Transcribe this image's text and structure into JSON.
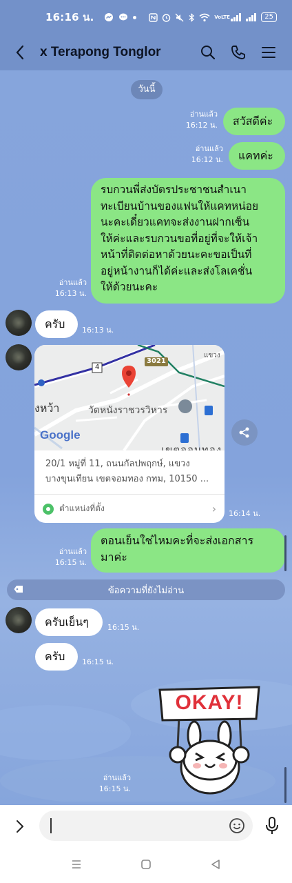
{
  "status": {
    "time": "16:16 น.",
    "network": "VoLTE",
    "battery": "25"
  },
  "header": {
    "title": "x Terapong Tonglor"
  },
  "chat": {
    "date_label": "วันนี้",
    "messages": [
      {
        "dir": "out",
        "text": "สวัสดีค่ะ",
        "read": "อ่านแล้ว",
        "time": "16:12 น."
      },
      {
        "dir": "out",
        "text": "แคทค่ะ",
        "read": "อ่านแล้ว",
        "time": "16:12 น."
      },
      {
        "dir": "out",
        "lines": [
          "รบกวนพี่ส่งบัตรประชาชนสำเนา",
          "ทะเบียนบ้านของแฟนให้แคทหน่อย",
          "นะคะเดี๋ยวแคทจะส่งงานฝากเซ็น",
          "ให้ค่ะและรบกวนขอที่อยู่ที่จะให้เจ้า",
          "หน้าที่ติดต่อหาด้วยนะคะขอเป็นที่",
          "อยู่หน้างานก็ได้ค่ะและส่งโลเคชั่น",
          "ให้ด้วยนะคะ"
        ],
        "read": "อ่านแล้ว",
        "time": "16:13 น."
      },
      {
        "dir": "in",
        "text": "ครับ",
        "time": "16:13 น."
      },
      {
        "dir": "in",
        "type": "location",
        "time": "16:14 น."
      },
      {
        "dir": "out",
        "lines": [
          "ตอนเย็นใช่ไหมคะที่จะส่งเอกสาร",
          "มาค่ะ"
        ],
        "read": "อ่านแล้ว",
        "time": "16:15 น."
      },
      {
        "dir": "in",
        "text": "ครับเย็นๆ",
        "time": "16:15 น."
      },
      {
        "dir": "in",
        "text": "ครับ",
        "time": "16:15 น."
      },
      {
        "dir": "out",
        "type": "sticker",
        "read": "อ่านแล้ว",
        "time": "16:15 น."
      }
    ],
    "location": {
      "address_line1": "20/1 หมู่ที่ 11, ถนนกัลปพฤกษ์, แขวง",
      "address_line2": "บางขุนเทียน เขตจอมทอง กทม, 10150 ...",
      "footer_label": "ตำแหน่งที่ตั้ง",
      "map_labels": {
        "road_num": "3021",
        "road_4": "4",
        "temple": "วัดหนังราชวรวิหาร",
        "area_left": "งหว้า",
        "district": "เขตจอมทอง",
        "top_right": "แขวง",
        "google": "Google"
      }
    },
    "unread_label": "ข้อความที่ยังไม่อ่าน",
    "sticker_text": "OKAY!"
  },
  "input": {
    "placeholder": ""
  },
  "colors": {
    "bg": "#84a3dc",
    "out_bubble": "#8be685",
    "header": "#7391c9"
  }
}
